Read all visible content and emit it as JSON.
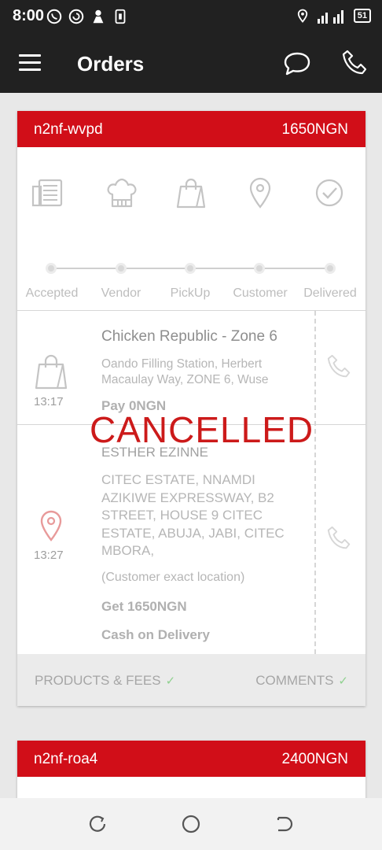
{
  "status_bar": {
    "time": "8:00",
    "battery": "51"
  },
  "app_bar": {
    "title": "Orders"
  },
  "orders": [
    {
      "id": "n2nf-wvpd",
      "amount": "1650NGN",
      "steps": [
        "Accepted",
        "Vendor",
        "PickUp",
        "Customer",
        "Delivered"
      ],
      "pickup": {
        "time": "13:17",
        "vendor_name": "Chicken Republic - Zone 6",
        "address": "Oando Filling Station, Herbert Macaulay Way, ZONE 6, Wuse",
        "payment": "Pay 0NGN"
      },
      "dropoff": {
        "time": "13:27",
        "customer_name": "ESTHER EZINNE",
        "address": "CITEC ESTATE, NNAMDI AZIKIWE EXPRESSWAY, B2 STREET, HOUSE 9 CITEC ESTATE, ABUJA, JABI, CITEC MBORA,",
        "location_note": "(Customer exact location)",
        "collect": "Get 1650NGN",
        "payment_method": "Cash on Delivery"
      },
      "status_overlay": "CANCELLED",
      "footer": {
        "products_label": "PRODUCTS & FEES",
        "comments_label": "COMMENTS"
      }
    },
    {
      "id": "n2nf-roa4",
      "amount": "2400NGN"
    }
  ],
  "colors": {
    "accent": "#d10e18",
    "toolbar": "#212121"
  },
  "icons": {
    "steps": [
      "receipt-icon",
      "chef-hat-icon",
      "shopping-bag-icon",
      "location-pin-icon",
      "check-circle-icon"
    ]
  }
}
